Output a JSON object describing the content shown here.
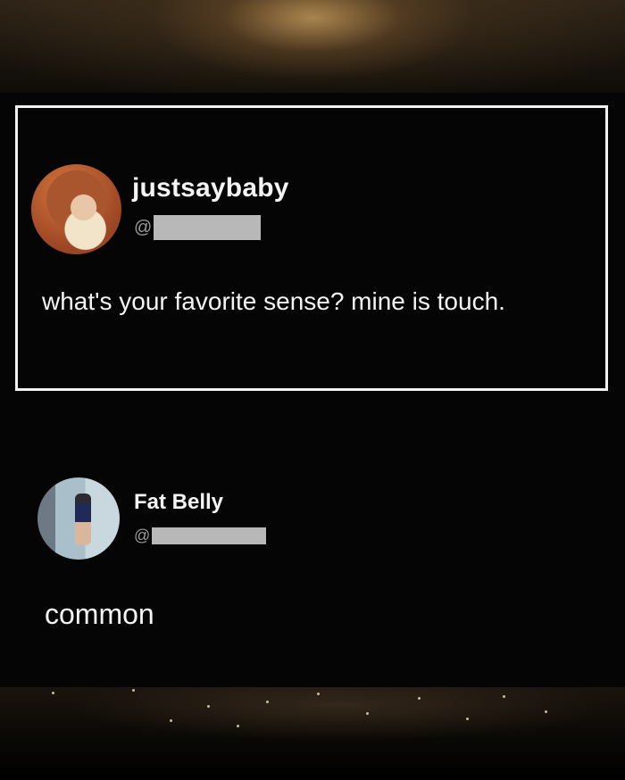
{
  "tweet": {
    "display_name": "justsaybaby",
    "handle_prefix": "@",
    "text": "what's your favorite sense? mine is touch."
  },
  "reply": {
    "display_name": "Fat Belly",
    "handle_prefix": "@",
    "text": "common"
  },
  "colors": {
    "background": "#050505",
    "text": "#f4f4f4",
    "handle": "#9a9a9a",
    "border": "#f2f2f2",
    "redaction": "#b8b8b8"
  },
  "icons": {
    "tweet_avatar": "profile-photo",
    "reply_avatar": "profile-photo"
  }
}
